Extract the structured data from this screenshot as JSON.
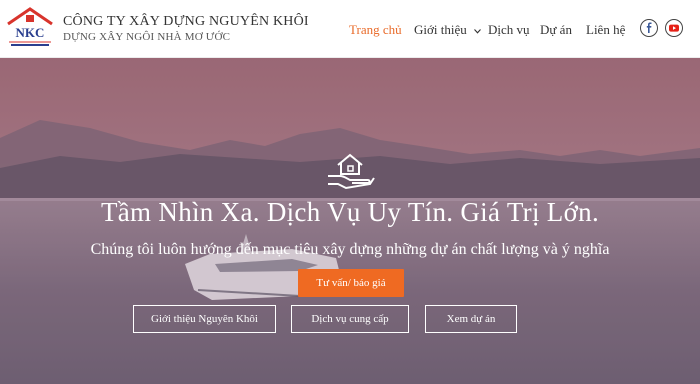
{
  "header": {
    "company_name": "CÔNG TY XÂY DỰNG NGUYÊN KHÔI",
    "slogan": "DỰNG XÂY NGÔI NHÀ MƠ ƯỚC",
    "logo_letters": "NKC",
    "nav": [
      {
        "label": "Trang chủ",
        "active": true
      },
      {
        "label": "Giới thiệu",
        "has_dropdown": true
      },
      {
        "label": "Dịch vụ"
      },
      {
        "label": "Dự án"
      },
      {
        "label": "Liên hệ"
      }
    ],
    "social": [
      "facebook-icon",
      "youtube-icon"
    ],
    "accent": "#e96b2a"
  },
  "hero": {
    "headline": "Tầm Nhìn Xa. Dịch Vụ Uy Tín. Giá Trị Lớn.",
    "subline": "Chúng tôi luôn hướng đến mục tiêu xây dựng những dự án chất lượng và ý nghĩa",
    "cta_primary": "Tư vấn/ báo giá",
    "cta_buttons": [
      "Giới thiệu Nguyên Khôi",
      "Dịch vụ cung cấp",
      "Xem dự án"
    ],
    "icon": "house-hand-icon",
    "primary_color": "#ef6a22"
  }
}
